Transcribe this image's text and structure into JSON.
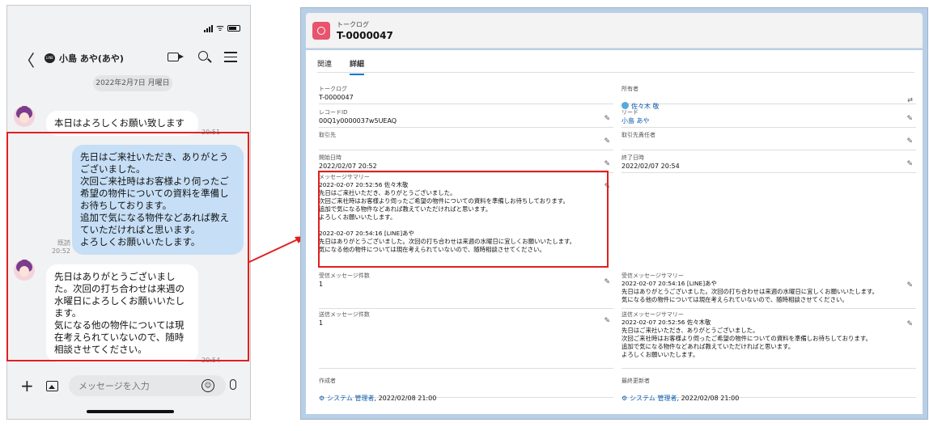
{
  "phone": {
    "status_wifi": "ᯤ",
    "chat": {
      "back_glyph": "〈",
      "line_badge": "LINE",
      "title": "小島 あや(あや)",
      "emoji_glyph": "☺"
    },
    "date": "2022年2月7日 月曜日",
    "messages": [
      {
        "text": "本日はよろしくお願い致します",
        "time": "20:51"
      },
      {
        "text": "先日はご来社いただき、ありがとう\nございました。\n次回ご来社時はお客様より伺ったご\n希望の物件についての資料を準備し\nお待ちしております。\n追加で気になる物件などあれば教え\nていただければと思います。\nよろしくお願いいたします。",
        "read": "既読",
        "time": "20:52"
      },
      {
        "text": "先日はありがとうございまし\nた。次回の打ち合わせは来週の\n水曜日によろしくお願いいたし\nます。\n気になる他の物件については現\n在考えられていないので、随時\n相談させてください。",
        "time": "20:54"
      }
    ],
    "input": {
      "plus_glyph": "+",
      "placeholder": "メッセージを入力"
    }
  },
  "record": {
    "object_label": "トークログ",
    "title": "T-0000047",
    "tabs": [
      {
        "label": "関連"
      },
      {
        "label": "詳細"
      }
    ],
    "fields": {
      "talklog": {
        "label": "トークログ",
        "value": "T-0000047"
      },
      "owner": {
        "label": "所有者",
        "value": "佐々木 敬"
      },
      "record_id": {
        "label": "レコードID",
        "value": "00Q1y0000037w5UEAQ"
      },
      "lead": {
        "label": "リード",
        "value": "小島 あや"
      },
      "account": {
        "label": "取引先",
        "value": ""
      },
      "account_owner": {
        "label": "取引先責任者",
        "value": ""
      },
      "start": {
        "label": "開始日時",
        "value": "2022/02/07 20:52"
      },
      "end": {
        "label": "終了日時",
        "value": "2022/02/07 20:54"
      },
      "summary": {
        "label": "メッセージサマリー",
        "value": "2022-02-07 20:52:56 佐々木敬\n先日はご来社いただき、ありがとうございました。\n次回ご来社時はお客様より伺ったご希望の物件についての資料を準備しお待ちしております。\n追加で気になる物件などあれば教えていただければと思います。\nよろしくお願いいたします。\n\n2022-02-07 20:54:16 [LINE]あや\n先日はありがとうございました。次回の打ち合わせは来週の水曜日に宜しくお願いいたします。\n気になる他の物件については現在考えられていないので、随時相談させてください。"
      },
      "received_count": {
        "label": "受信メッセージ件数",
        "value": "1"
      },
      "received_summary": {
        "label": "受信メッセージサマリー",
        "value": "2022-02-07 20:54:16 [LINE]あや\n先日はありがとうございました。次回の打ち合わせは来週の水曜日に宜しくお願いいたします。\n気になる他の物件については現在考えられていないので、随時相談させてください。"
      },
      "sent_count": {
        "label": "送信メッセージ件数",
        "value": "1"
      },
      "sent_summary": {
        "label": "送信メッセージサマリー",
        "value": "2022-02-07 20:52:56 佐々木敬\n先日はご来社いただき、ありがとうございました。\n次回ご来社時はお客様より伺ったご希望の物件についての資料を準備しお待ちしております。\n追加で気になる物件などあれば教えていただければと思います。\nよろしくお願いいたします。"
      },
      "created_by": {
        "label": "作成者",
        "user": "システム 管理者",
        "date": ", 2022/02/08 21:00"
      },
      "modified_by": {
        "label": "最終更新者",
        "user": "システム 管理者",
        "date": ", 2022/02/08 21:00"
      }
    },
    "pencil_glyph": "✎",
    "change_owner_glyph": "⇄"
  },
  "colors": {
    "highlight": "#e02020",
    "bubble_out": "#c6dff6",
    "link": "#0b5cab",
    "object_icon": "#e8536d",
    "frame_bg": "#b8cfe6"
  }
}
